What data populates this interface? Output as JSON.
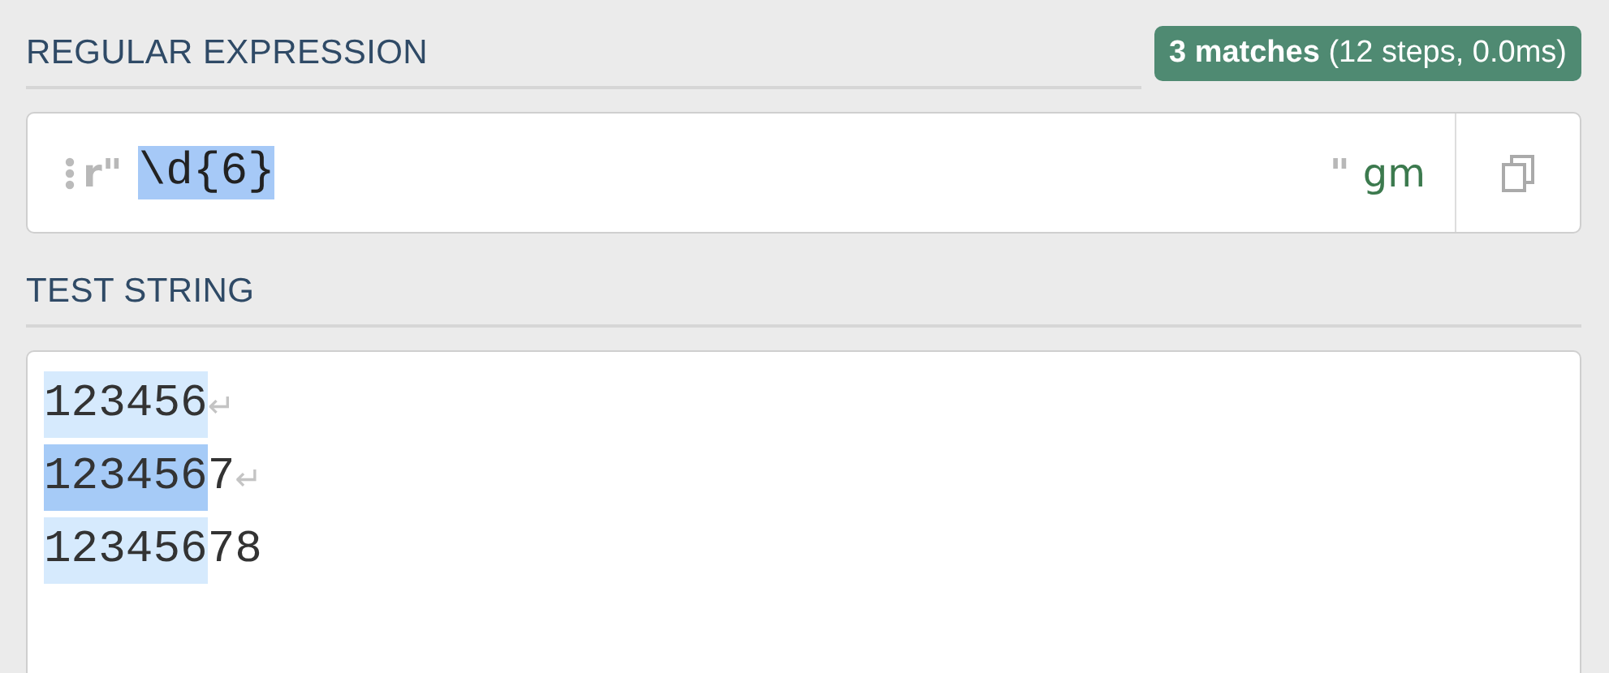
{
  "regex": {
    "heading": "REGULAR EXPRESSION",
    "status": "**3 matches** (12 steps, 0.0ms)",
    "delimiter_open": "r\"",
    "pattern": "\\d{6}",
    "pattern_selected": true,
    "delimiter_close": "\"",
    "flags": "gm"
  },
  "test_string": {
    "heading": "TEST STRING",
    "lines": [
      {
        "match": "123456",
        "newline": "↵",
        "selected": false
      },
      {
        "match": "123456",
        "rest": "7",
        "newline": "↵",
        "selected": true
      },
      {
        "match": "123456",
        "rest": "78",
        "selected": false
      }
    ]
  }
}
